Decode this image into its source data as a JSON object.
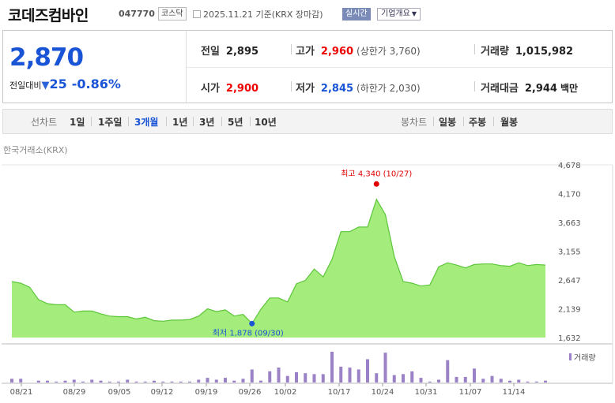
{
  "header": {
    "company_name": "코데즈컴바인",
    "stock_code": "047770",
    "market": "코스닥",
    "date_text": "2025.11.21 기준(KRX 장마감)",
    "realtime_button": "실시간",
    "company_overview_button": "기업개요",
    "dropdown_icon": "chevron-down-icon"
  },
  "summary": {
    "current_price": "2,870",
    "change_label": "전일대비",
    "change_icon": "down-triangle-icon",
    "change_value": "25",
    "change_percent": "-0.86%",
    "prev_close_label": "전일",
    "prev_close": "2,895",
    "high_label": "고가",
    "high": "2,960",
    "upper_limit": "(상한가 3,760)",
    "volume_label": "거래량",
    "volume": "1,015,982",
    "open_label": "시가",
    "open": "2,900",
    "low_label": "저가",
    "low": "2,845",
    "lower_limit": "(하한가 2,030)",
    "trade_value_label": "거래대금",
    "trade_value": "2,944",
    "trade_value_unit": "백만"
  },
  "chart_tabs": {
    "line_label": "선차트",
    "periods": [
      "1일",
      "1주일",
      "3개월",
      "1년",
      "3년",
      "5년",
      "10년"
    ],
    "selected_period": "3개월",
    "candle_label": "봉차트",
    "candles": [
      "일봉",
      "주봉",
      "월봉"
    ]
  },
  "chart_source": "한국거래소(KRX)",
  "colors": {
    "accent": "#1954d6",
    "up": "#e00000",
    "area_fill": "#9aea6e",
    "area_line": "#5cc63a",
    "volume_bar": "#9b82c6"
  },
  "chart_data": {
    "type": "area",
    "x_ticks": [
      "08/21",
      "08/29",
      "09/05",
      "09/12",
      "09/19",
      "09/26",
      "10/02",
      "10/17",
      "10/24",
      "10/31",
      "11/07",
      "11/14"
    ],
    "y_ticks": [
      "4,678",
      "4,170",
      "3,663",
      "3,155",
      "2,647",
      "2,139",
      "1,632"
    ],
    "ylim": [
      1632,
      4678
    ],
    "values": [
      2620,
      2590,
      2520,
      2300,
      2230,
      2210,
      2210,
      2080,
      2100,
      2100,
      2050,
      2010,
      2000,
      2000,
      1960,
      1990,
      1930,
      1920,
      1940,
      1940,
      1950,
      2010,
      2140,
      2090,
      2120,
      2010,
      2040,
      1880,
      2130,
      2330,
      2330,
      2260,
      2580,
      2640,
      2840,
      2700,
      3010,
      3500,
      3500,
      3580,
      3580,
      4070,
      3800,
      3060,
      2620,
      2590,
      2540,
      2560,
      2880,
      2950,
      2910,
      2860,
      2920,
      2930,
      2930,
      2900,
      2890,
      2950,
      2900,
      2920,
      2910
    ],
    "high_annotation": "최고 4,340 (10/27)",
    "low_annotation": "최저 1,878 (09/30)",
    "high_value": 4340,
    "low_value": 1878,
    "high_index": 41,
    "low_index": 27,
    "volume_legend": "거래량",
    "volume": [
      4,
      4,
      0,
      2,
      2,
      1,
      2,
      3,
      1,
      3,
      2,
      1,
      1,
      3,
      1,
      1,
      2,
      1,
      1,
      1,
      1,
      3,
      5,
      3,
      5,
      2,
      4,
      14,
      2,
      12,
      16,
      7,
      11,
      10,
      9,
      9,
      33,
      17,
      16,
      14,
      25,
      10,
      32,
      8,
      9,
      12,
      5,
      1,
      3,
      24,
      6,
      6,
      15,
      4,
      7,
      4,
      2,
      3,
      1,
      1,
      2
    ]
  }
}
